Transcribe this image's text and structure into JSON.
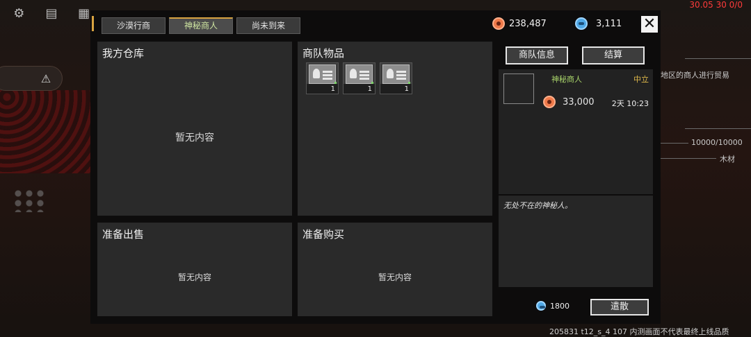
{
  "background": {
    "top_right_stat": "30.05 30 0/0",
    "right_texts": [
      "地区的商人进行贸易",
      "10000/10000",
      "木材"
    ],
    "build_info": "205831 t12_s_4 107 内测画面不代表最终上线品质"
  },
  "tabs": [
    {
      "label": "沙漠行商",
      "active": false
    },
    {
      "label": "神秘商人",
      "active": true
    },
    {
      "label": "尚未到来",
      "active": false
    }
  ],
  "currency": {
    "gold": "238,487",
    "gems": "3,111"
  },
  "boxes": {
    "warehouse": {
      "title": "我方仓库",
      "empty": "暂无内容"
    },
    "caravan": {
      "title": "商队物品",
      "items": [
        {
          "count": "1"
        },
        {
          "count": "1"
        },
        {
          "count": "1"
        }
      ]
    },
    "sell": {
      "title": "准备出售",
      "empty": "暂无内容"
    },
    "buy": {
      "title": "准备购买",
      "empty": "暂无内容"
    }
  },
  "right_panel": {
    "info_button": "商队信息",
    "settle_button": "结算",
    "merchant": {
      "name": "神秘商人",
      "standing": "中立",
      "price": "33,000",
      "time": "2天 10:23"
    },
    "description": "无处不在的神秘人。",
    "dismiss_cost": "1800",
    "dismiss_button": "遣散"
  },
  "colors": {
    "accent": "#d9a441",
    "merchant_name": "#a8d36a",
    "standing": "#e0b94a",
    "gold_coin": "#f07a4a",
    "gem": "#4fa8e6"
  }
}
